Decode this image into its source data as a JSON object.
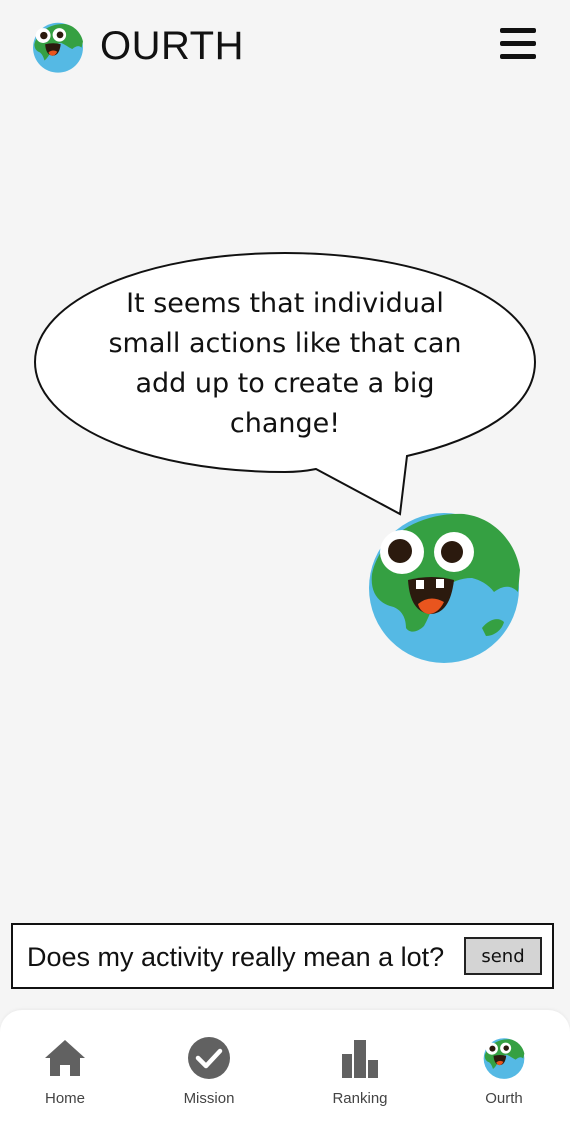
{
  "header": {
    "title": "OURTH",
    "logo_icon": "earth-mascot-icon",
    "menu_icon": "hamburger-menu-icon"
  },
  "speech_bubble": {
    "text": "It seems that individual small actions like that can add up to create a big change!"
  },
  "mascot": {
    "icon": "earth-mascot-icon"
  },
  "chat_input": {
    "value": "Does my activity really mean a lot?",
    "send_label": "send"
  },
  "bottom_nav": {
    "items": [
      {
        "label": "Home",
        "icon": "home-icon"
      },
      {
        "label": "Mission",
        "icon": "check-circle-icon"
      },
      {
        "label": "Ranking",
        "icon": "ranking-bars-icon"
      },
      {
        "label": "Ourth",
        "icon": "earth-mascot-icon"
      }
    ]
  },
  "colors": {
    "background": "#f5f5f5",
    "earth_ocean": "#4fb8e6",
    "earth_land": "#35a042",
    "mouth": "#e8551e",
    "nav_icon": "#616161"
  }
}
